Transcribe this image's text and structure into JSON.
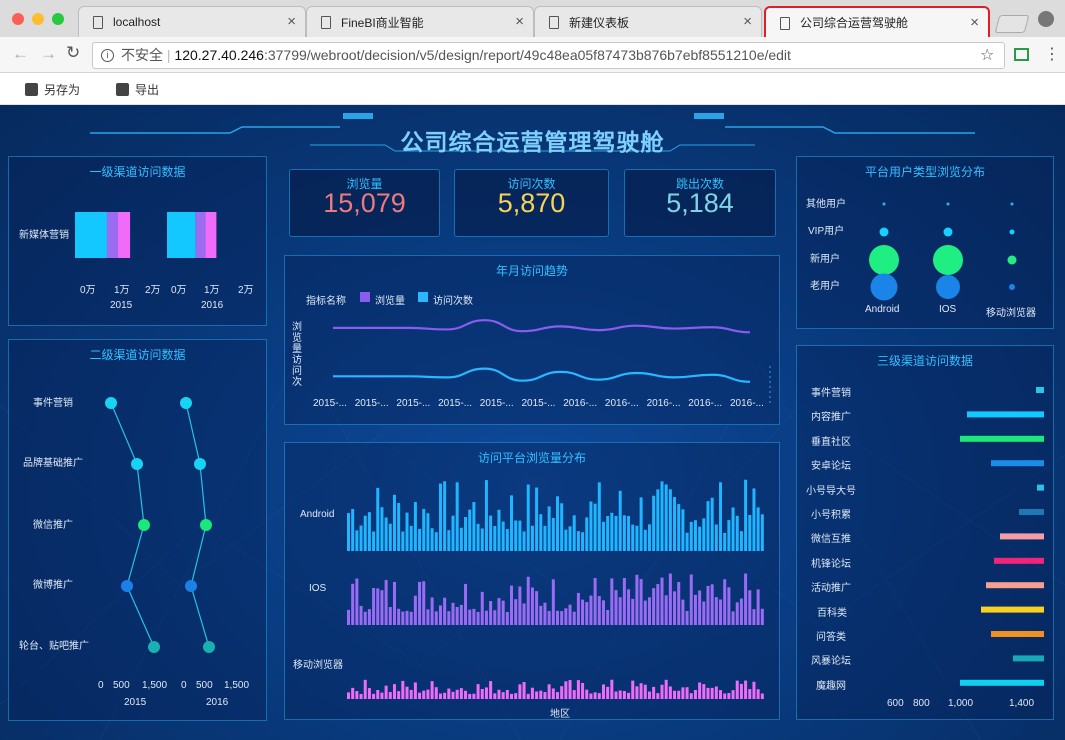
{
  "browser": {
    "tabs": [
      {
        "label": "localhost"
      },
      {
        "label": "FineBI商业智能"
      },
      {
        "label": "新建仪表板"
      },
      {
        "label": "公司综合运营驾驶舱"
      }
    ],
    "security_label": "不安全",
    "url_host": "120.27.40.246",
    "url_rest": ":37799/webroot/decision/v5/design/report/49c48ea05f87473b876b7ebf8551210e/edit"
  },
  "toolbar": {
    "save_as": "另存为",
    "export": "导出"
  },
  "dashboard": {
    "title": "公司综合运营管理驾驶舱",
    "kpis": [
      {
        "label": "浏览量",
        "value": "15,079",
        "color": "#ec7a7f"
      },
      {
        "label": "访问次数",
        "value": "5,870",
        "color": "#f7d356"
      },
      {
        "label": "跳出次数",
        "value": "5,184",
        "color": "#7fd4e4"
      }
    ],
    "panel1": {
      "title": "一级渠道访问数据",
      "category": "新媒体营销",
      "ticks": [
        "0万",
        "1万",
        "2万"
      ],
      "years": [
        "2015",
        "2016"
      ]
    },
    "panel2": {
      "title": "二级渠道访问数据",
      "categories": [
        "事件营销",
        "品牌基础推广",
        "微信推广",
        "微博推广",
        "轮台、贴吧推广"
      ],
      "ticks": [
        "0",
        "500",
        "1,500"
      ],
      "years": [
        "2015",
        "2016"
      ]
    },
    "panel3": {
      "title": "年月访问趋势",
      "legend_title": "指标名称",
      "legend": [
        {
          "name": "浏览量",
          "color": "#8a5cf0"
        },
        {
          "name": "访问次数",
          "color": "#29b8ff"
        }
      ],
      "ylabel": "浏览量访问次",
      "xlabels": [
        "2015-...",
        "2015-...",
        "2015-...",
        "2015-...",
        "2015-...",
        "2015-...",
        "2016-...",
        "2016-...",
        "2016-...",
        "2016-...",
        "2016-..."
      ]
    },
    "panel4": {
      "title": "访问平台浏览量分布",
      "rows": [
        "Android",
        "IOS",
        "移动浏览器"
      ],
      "xlabel": "地区"
    },
    "panel5": {
      "title": "平台用户类型浏览分布",
      "rows": [
        "其他用户",
        "VIP用户",
        "新用户",
        "老用户"
      ],
      "cols": [
        "Android",
        "IOS",
        "移动浏览器"
      ]
    },
    "panel6": {
      "title": "三级渠道访问数据",
      "ticks": [
        "600",
        "800",
        "1,000",
        "1,400"
      ]
    }
  },
  "chart_data": [
    {
      "type": "bar",
      "title": "一级渠道访问数据",
      "categories": [
        "新媒体营销"
      ],
      "series": [
        {
          "name": "2015",
          "values": [
            14500
          ]
        },
        {
          "name": "2016",
          "values": [
            13000
          ]
        }
      ]
    },
    {
      "type": "line",
      "title": "二级渠道访问数据",
      "categories": [
        "事件营销",
        "品牌基础推广",
        "微信推广",
        "微博推广",
        "轮台、贴吧推广"
      ],
      "series": [
        {
          "name": "2015",
          "values": [
            320,
            740,
            940,
            600,
            1260
          ]
        },
        {
          "name": "2016",
          "values": [
            60,
            340,
            520,
            180,
            580
          ]
        }
      ]
    },
    {
      "type": "line",
      "title": "年月访问趋势",
      "series": [
        {
          "name": "浏览量",
          "values": [
            0.55,
            0.55,
            0.55,
            0.48,
            0.9,
            0.4,
            0.62,
            0.45,
            0.65,
            0.52,
            0.58,
            0.35
          ]
        },
        {
          "name": "访问次数",
          "values": [
            0.35,
            0.35,
            0.35,
            0.3,
            0.7,
            0.15,
            0.55,
            0.2,
            0.5,
            0.3,
            0.42,
            0.1
          ]
        }
      ]
    },
    {
      "type": "bar",
      "title": "访问平台浏览量分布",
      "categories_count": 100,
      "series": [
        {
          "name": "Android"
        },
        {
          "name": "IOS"
        },
        {
          "name": "移动浏览器"
        }
      ]
    },
    {
      "type": "scatter",
      "title": "平台用户类型浏览分布",
      "x": [
        "Android",
        "IOS",
        "移动浏览器"
      ],
      "y": [
        "其他用户",
        "VIP用户",
        "新用户",
        "老用户"
      ],
      "values": [
        [
          0,
          0,
          0
        ],
        [
          0.3,
          0.3,
          0.1
        ],
        [
          1,
          1,
          0.3
        ],
        [
          0.9,
          0.8,
          0.2
        ]
      ]
    },
    {
      "type": "bar",
      "title": "三级渠道访问数据",
      "categories": [
        "事件营销",
        "内容推广",
        "垂直社区",
        "安卓论坛",
        "小号导大号",
        "小号积累",
        "微信互推",
        "机锋论坛",
        "活动推广",
        "百科类",
        "问答类",
        "风暴论坛",
        "魔趣网"
      ],
      "values": [
        1435,
        1390,
        1410,
        1400,
        1435,
        1420,
        1410,
        1400,
        1410,
        1400,
        1400,
        1420,
        1390
      ],
      "colors": [
        "#29c6e8",
        "#0fcbff",
        "#1ce87a",
        "#1b8de8",
        "#2cc0e8",
        "#1f77b4",
        "#f2a0a8",
        "#f0257a",
        "#f8a090",
        "#f8d020",
        "#f09020",
        "#18a8b8",
        "#0fd0f0"
      ]
    }
  ]
}
